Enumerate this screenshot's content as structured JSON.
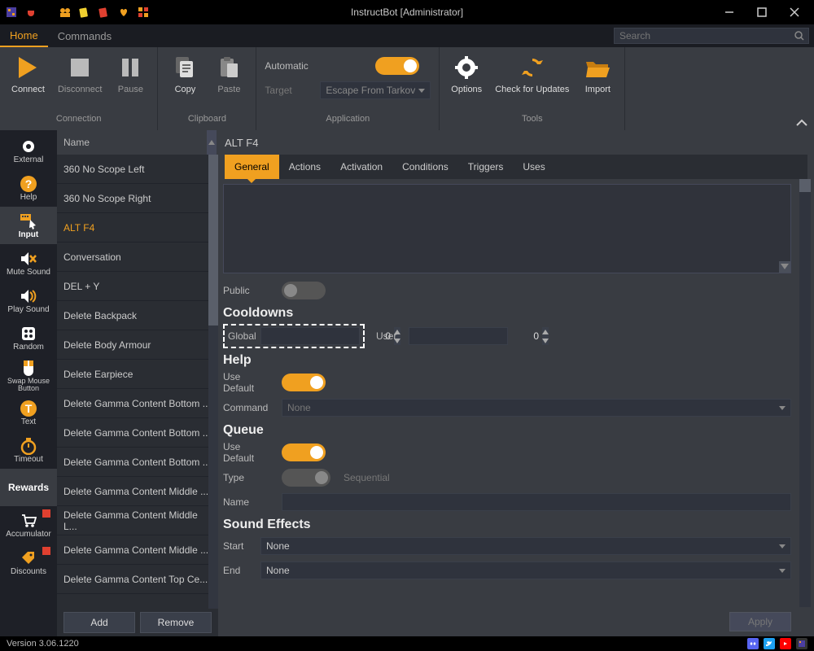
{
  "window": {
    "title": "InstructBot [Administrator]"
  },
  "menu": {
    "home": "Home",
    "commands": "Commands"
  },
  "search": {
    "placeholder": "Search"
  },
  "ribbon": {
    "connection": {
      "label": "Connection",
      "connect": "Connect",
      "disconnect": "Disconnect",
      "pause": "Pause"
    },
    "clipboard": {
      "label": "Clipboard",
      "copy": "Copy",
      "paste": "Paste"
    },
    "application": {
      "label": "Application",
      "automatic": "Automatic",
      "target": "Target",
      "target_value": "Escape From Tarkov"
    },
    "tools": {
      "label": "Tools",
      "options": "Options",
      "check": "Check for Updates",
      "import": "Import"
    }
  },
  "sidebar": {
    "items": [
      {
        "label": "External"
      },
      {
        "label": "Help"
      },
      {
        "label": "Input"
      },
      {
        "label": "Mute Sound"
      },
      {
        "label": "Play Sound"
      },
      {
        "label": "Random"
      },
      {
        "label": "Swap Mouse Button"
      },
      {
        "label": "Text"
      },
      {
        "label": "Timeout"
      },
      {
        "label": "Rewards"
      },
      {
        "label": "Accumulator"
      },
      {
        "label": "Discounts"
      }
    ]
  },
  "list": {
    "header": "Name",
    "items": [
      "360 No Scope Left",
      "360 No Scope Right",
      "ALT F4",
      "Conversation",
      "DEL + Y",
      "Delete Backpack",
      "Delete Body Armour",
      "Delete Earpiece",
      "Delete Gamma Content Bottom ...",
      "Delete Gamma Content Bottom ...",
      "Delete Gamma Content Bottom ...",
      "Delete Gamma Content Middle ...",
      "Delete Gamma Content Middle L...",
      "Delete Gamma Content Middle ...",
      "Delete Gamma Content Top Ce..."
    ],
    "add": "Add",
    "remove": "Remove"
  },
  "detail": {
    "title": "ALT F4",
    "tabs": [
      "General",
      "Actions",
      "Activation",
      "Conditions",
      "Triggers",
      "Uses"
    ],
    "public": "Public",
    "cooldowns": {
      "heading": "Cooldowns",
      "global": "Global",
      "global_val": "0",
      "user": "User",
      "user_val": "0"
    },
    "help": {
      "heading": "Help",
      "use_default": "Use Default",
      "command": "Command",
      "command_val": "None"
    },
    "queue": {
      "heading": "Queue",
      "use_default": "Use Default",
      "type": "Type",
      "type_val": "Sequential",
      "name": "Name",
      "name_val": ""
    },
    "sound": {
      "heading": "Sound Effects",
      "start": "Start",
      "start_val": "None",
      "end": "End",
      "end_val": "None"
    },
    "apply": "Apply"
  },
  "status": {
    "version": "Version 3.06.1220"
  },
  "colors": {
    "accent": "#f0a020"
  }
}
